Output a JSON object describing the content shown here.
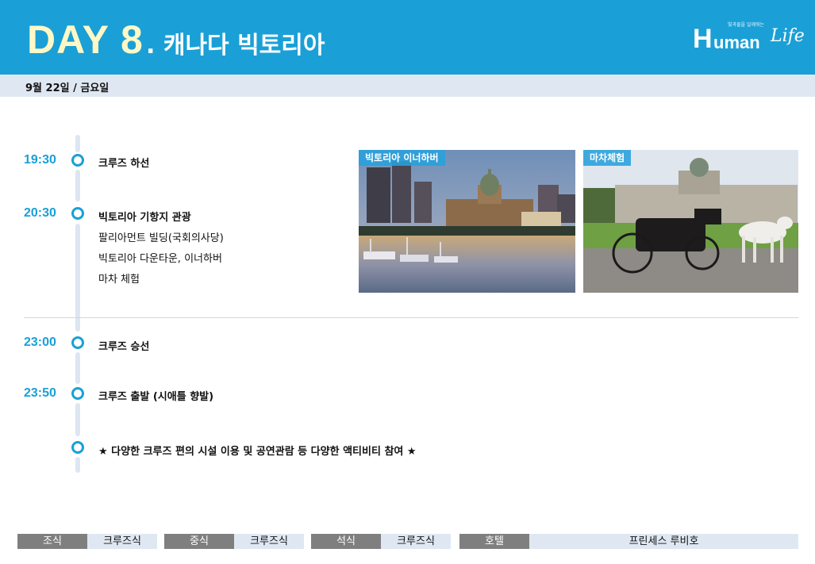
{
  "header": {
    "day_label": "DAY  8",
    "title": ". 캐나다 빅토리아",
    "logo": {
      "tagline": "빛과물을 일깨워는",
      "letter": "H",
      "word": "uman",
      "script": "Life"
    }
  },
  "date": "9월 22일 / 금요일",
  "schedule": [
    {
      "time": "19:30",
      "lines": [
        "크루즈 하선"
      ]
    },
    {
      "time": "20:30",
      "lines": [
        "빅토리아 기항지 관광",
        "팔리아먼트 빌딩(국회의사당)",
        "빅토리아 다운타운, 이너하버",
        "마차 체험"
      ]
    },
    {
      "time": "23:00",
      "lines": [
        "크루즈 승선"
      ]
    },
    {
      "time": "23:50",
      "lines": [
        "크루즈 출발 (시애틀 향발)"
      ]
    },
    {
      "time": "",
      "lines": [
        "★ 다양한 크루즈 편의 시설 이용 및 공연관람 등 다양한 액티비티 참여 ★"
      ]
    }
  ],
  "photos": [
    {
      "label": "빅토리아 이너하버"
    },
    {
      "label": "마차체험"
    }
  ],
  "meals": {
    "breakfast_label": "조식",
    "breakfast": "크루즈식",
    "lunch_label": "중식",
    "lunch": "크루즈식",
    "dinner_label": "석식",
    "dinner": "크루즈식",
    "hotel_label": "호텔",
    "hotel": "프린세스 루비호"
  },
  "colors": {
    "accent": "#1aa0d6",
    "day_text": "#fff8c6",
    "subbar": "#dfe8f2",
    "meal_label_bg": "#7f7f7f"
  }
}
